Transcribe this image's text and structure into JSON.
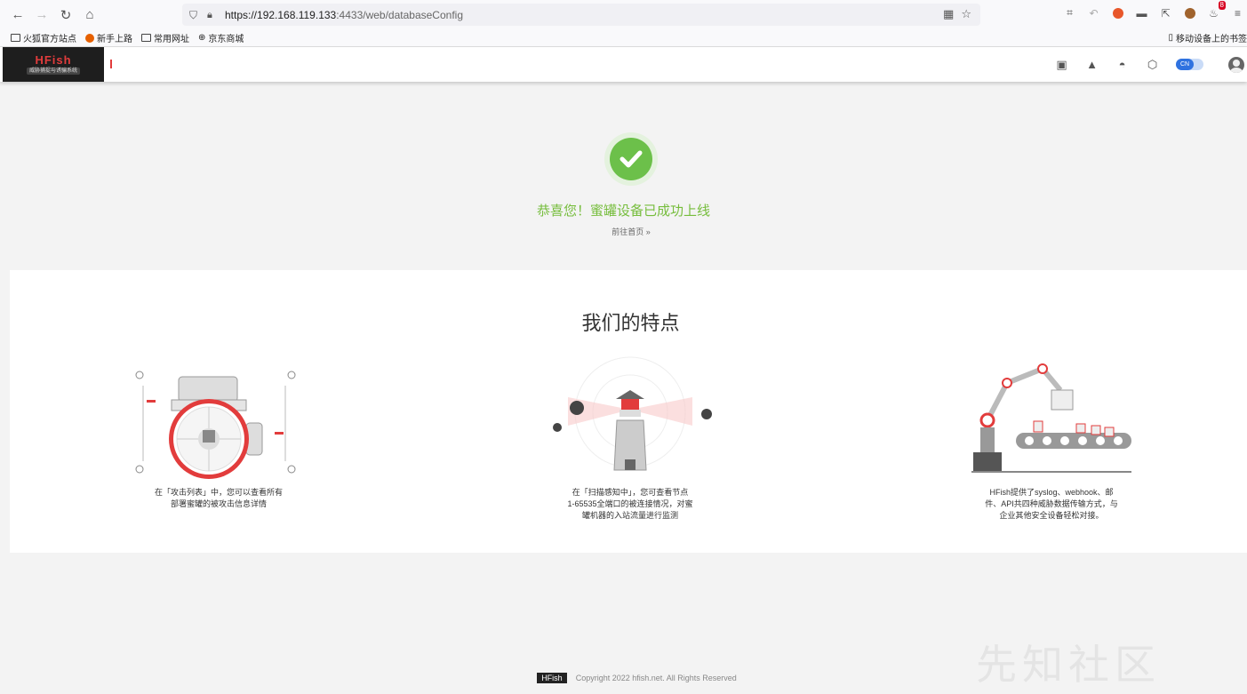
{
  "browser": {
    "url_host": "https://192.168.119.133",
    "url_path": ":4433/web/databaseConfig",
    "notification_count": "8",
    "bookmarks": [
      "火狐官方站点",
      "新手上路",
      "常用网址",
      "京东商城"
    ],
    "mobile_bookmarks": "移动设备上的书签"
  },
  "app": {
    "logo_title": "HFish",
    "logo_subtitle": "威胁捕捉与诱骗系统",
    "lang_label": "CN"
  },
  "success": {
    "title": "恭喜您！蜜罐设备已成功上线",
    "goto_home": "前往首页 »"
  },
  "features": {
    "title": "我们的特点",
    "items": [
      {
        "text_line1": "在「攻击列表」中，您可以查看所有",
        "text_line2": "部署蜜罐的被攻击信息详情"
      },
      {
        "text_line1": "在「扫描感知中」，您可查看节点",
        "text_line2": "1-65535全端口的被连接情况，对蜜",
        "text_line3": "罐机器的入站流量进行监测"
      },
      {
        "text_line1": "HFish提供了syslog、webhook、邮",
        "text_line2": "件、API共四种威胁数据传输方式，与",
        "text_line3": "企业其他安全设备轻松对接。"
      }
    ]
  },
  "footer": {
    "brand": "HFish",
    "copyright": "Copyright 2022 hfish.net. All Rights Reserved"
  },
  "watermark": "先知社区",
  "colors": {
    "success_green": "#6cc04a",
    "brand_red": "#e23c3c"
  }
}
